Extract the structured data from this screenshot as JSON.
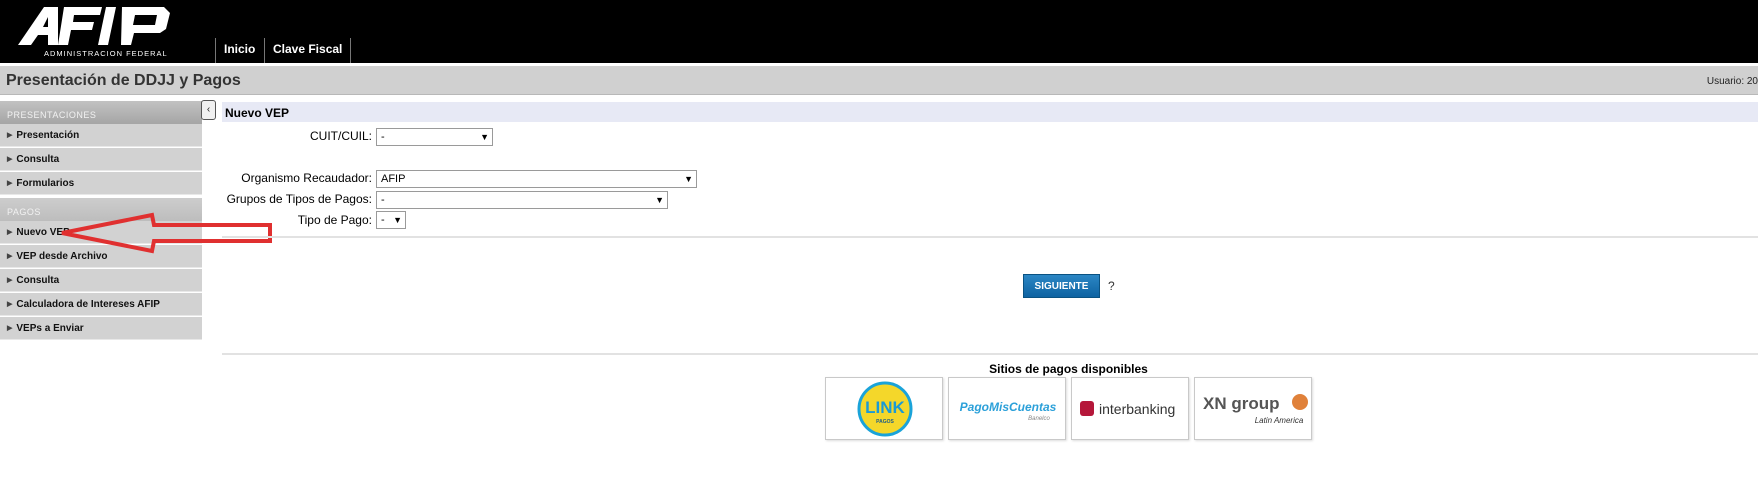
{
  "header": {
    "logo_text": "AFIP",
    "logo_subtext": "ADMINISTRACION FEDERAL",
    "nav": [
      "Inicio",
      "Clave Fiscal"
    ]
  },
  "title_bar": {
    "title": "Presentación de DDJJ y Pagos",
    "user_label": "Usuario: 20"
  },
  "sidebar": {
    "collapse_glyph": "‹",
    "sections": [
      {
        "title": "PRESENTACIONES",
        "items": [
          "Presentación",
          "Consulta",
          "Formularios"
        ]
      },
      {
        "title": "PAGOS",
        "items": [
          "Nuevo VEP",
          "VEP desde Archivo",
          "Consulta",
          "Calculadora de Intereses AFIP",
          "VEPs a Enviar"
        ]
      }
    ]
  },
  "form": {
    "title": "Nuevo VEP",
    "cuit": {
      "label": "CUIT/CUIL:",
      "value": "-"
    },
    "organismo": {
      "label": "Organismo Recaudador:",
      "value": "AFIP"
    },
    "grupos": {
      "label": "Grupos de Tipos de Pagos:",
      "value": "-"
    },
    "tipo": {
      "label": "Tipo de Pago:",
      "value": "-"
    },
    "siguiente_label": "SIGUIENTE",
    "help": "?"
  },
  "payment_sites": {
    "title": "Sitios de pagos disponibles",
    "logos": [
      {
        "name": "link-pagos",
        "text": "LINK",
        "sub": "PAGOS"
      },
      {
        "name": "pagomiscuentas",
        "text": "PagoMisCuentas",
        "sub": "Banelco"
      },
      {
        "name": "interbanking",
        "text": "interbanking"
      },
      {
        "name": "xn-group",
        "text": "XN group",
        "sub": "Latin America"
      }
    ]
  },
  "colors": {
    "top_bar": "#000000",
    "button": "#1673b3",
    "annotation_arrow": "#e03030"
  }
}
